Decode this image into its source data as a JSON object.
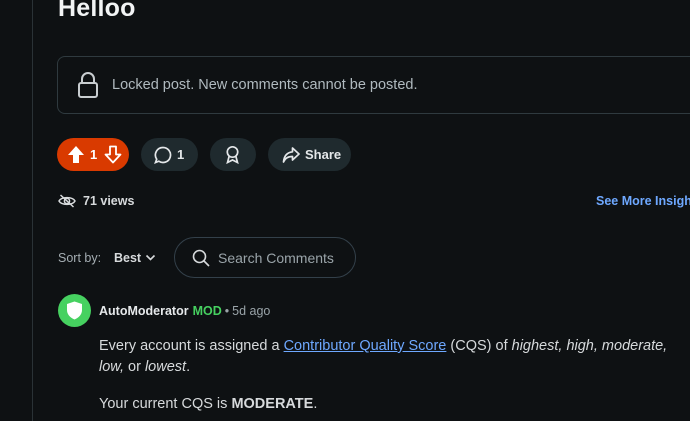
{
  "post": {
    "title": "Helloo",
    "locked_message": "Locked post. New comments cannot be posted."
  },
  "actions": {
    "vote_count": "1",
    "comment_count": "1",
    "share_label": "Share"
  },
  "stats": {
    "views_label": "71 views",
    "insights_label": "See More Insights"
  },
  "sort": {
    "label": "Sort by:",
    "value": "Best"
  },
  "search": {
    "placeholder": "Search Comments"
  },
  "comment": {
    "author": "AutoModerator",
    "badge": "MOD",
    "separator": "•",
    "age": "5d ago",
    "p1_prefix": "Every account is assigned a ",
    "p1_link": "Contributor Quality Score",
    "p1_middle": " (CQS) of ",
    "p1_levels": "highest, high, moderate, low,",
    "p1_or": " or ",
    "p1_last": "lowest",
    "p1_end": ".",
    "p2_prefix": "Your current CQS is ",
    "p2_value": "MODERATE",
    "p2_end": "."
  },
  "colors": {
    "background": "#0e1113",
    "upvote_active": "#d93a00",
    "link": "#6ea8ff",
    "mod_green": "#46d160"
  }
}
